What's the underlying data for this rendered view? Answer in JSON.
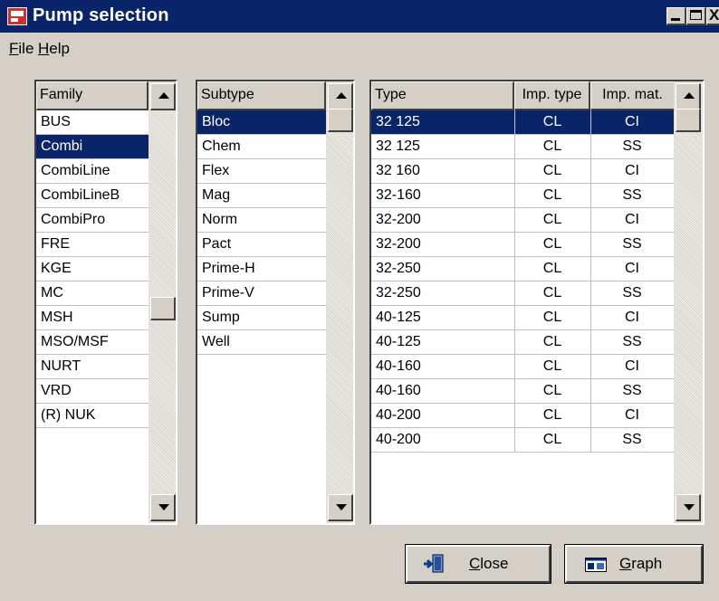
{
  "window": {
    "title": "Pump selection",
    "controls": {
      "minimize_icon": "minimize-icon",
      "maximize_icon": "maximize-icon",
      "close_icon": "close-icon",
      "close_glyph": "X"
    }
  },
  "menu": {
    "items": [
      "File",
      "Help"
    ]
  },
  "family_list": {
    "header": "Family",
    "items": [
      "BUS",
      "Combi",
      "CombiLine",
      "CombiLineB",
      "CombiPro",
      "FRE",
      "KGE",
      "MC",
      "MSH",
      "MSO/MSF",
      "NURT",
      "VRD",
      "(R) NUK"
    ],
    "selected": "Combi"
  },
  "subtype_list": {
    "header": "Subtype",
    "items": [
      "Bloc",
      "Chem",
      "Flex",
      "Mag",
      "Norm",
      "Pact",
      "Prime-H",
      "Prime-V",
      "Sump",
      "Well"
    ],
    "selected": "Bloc"
  },
  "type_table": {
    "columns": [
      "Type",
      "Imp. type",
      "Imp. mat."
    ],
    "rows": [
      [
        "32 125",
        "CL",
        "CI"
      ],
      [
        "32 125",
        "CL",
        "SS"
      ],
      [
        "32 160",
        "CL",
        "CI"
      ],
      [
        "32-160",
        "CL",
        "SS"
      ],
      [
        "32-200",
        "CL",
        "CI"
      ],
      [
        "32-200",
        "CL",
        "SS"
      ],
      [
        "32-250",
        "CL",
        "CI"
      ],
      [
        "32-250",
        "CL",
        "SS"
      ],
      [
        "40-125",
        "CL",
        "CI"
      ],
      [
        "40-125",
        "CL",
        "SS"
      ],
      [
        "40-160",
        "CL",
        "CI"
      ],
      [
        "40-160",
        "CL",
        "SS"
      ],
      [
        "40-200",
        "CL",
        "CI"
      ],
      [
        "40-200",
        "CL",
        "SS"
      ]
    ],
    "selected_row": 0
  },
  "buttons": {
    "close": {
      "label": "Close",
      "icon": "door-exit-icon"
    },
    "graph": {
      "label": "Graph",
      "icon": "graph-icon"
    }
  },
  "colors": {
    "selection": "#0a246a",
    "face": "#d4d0c8"
  }
}
